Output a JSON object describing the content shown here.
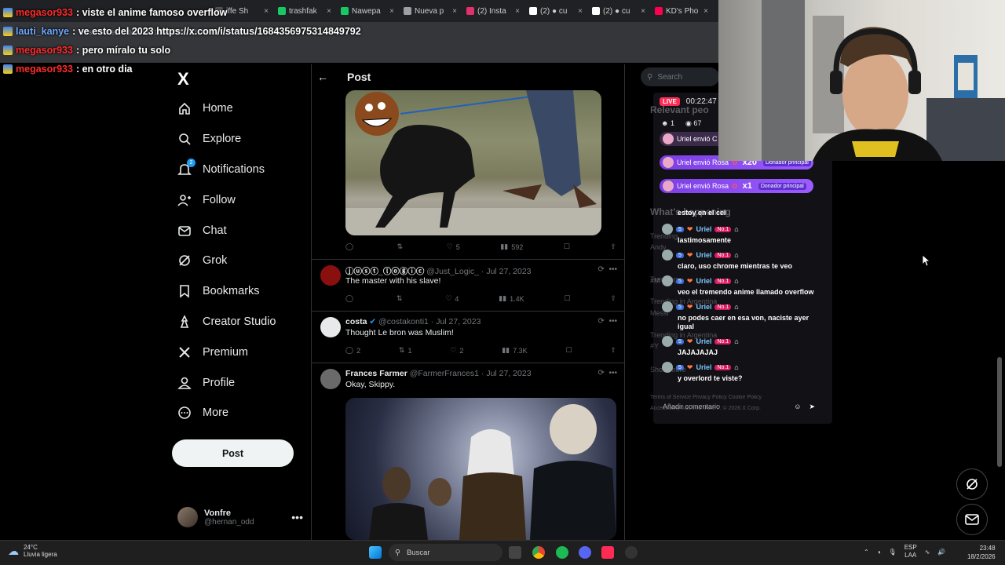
{
  "browser": {
    "tabs": [
      {
        "label": "iffe Sh",
        "color": "#555555"
      },
      {
        "label": "trashfak",
        "color": "#17c964"
      },
      {
        "label": "Nawepa",
        "color": "#17c964"
      },
      {
        "label": "Nueva p",
        "color": "#9aa0a6"
      },
      {
        "label": "(2) Insta",
        "color": "#e1306c"
      },
      {
        "label": "(2) ● cu",
        "color": "#ffffff"
      },
      {
        "label": "(2) ● cu",
        "color": "#ffffff"
      },
      {
        "label": "KD's Pho",
        "color": "#ff0050"
      }
    ],
    "address_fragment": "Vision4theBlind/status/1684356975314849792"
  },
  "stream_chat": [
    {
      "user": "megasor933",
      "text": ": viste el anime famoso overflow",
      "user_color": "red"
    },
    {
      "user": "lauti_kanye",
      "text": ": ve esto del 2023 https://x.com/i/status/1684356975314849792",
      "user_color": "blue"
    },
    {
      "user": "megasor933",
      "text": ": pero míralo tu solo",
      "user_color": "red"
    },
    {
      "user": "megasor933",
      "text": ": en otro dia",
      "user_color": "red"
    }
  ],
  "nav": {
    "logo": "X",
    "items": [
      "Home",
      "Explore",
      "Notifications",
      "Follow",
      "Chat",
      "Grok",
      "Bookmarks",
      "Creator Studio",
      "Premium",
      "Profile",
      "More"
    ],
    "notifications_badge": "2",
    "post_button": "Post"
  },
  "account": {
    "name": "Vonfre",
    "handle": "@hernan_odd",
    "menu": "•••"
  },
  "feed": {
    "title": "Post",
    "first_actions": {
      "reply": "",
      "repost": "",
      "like": "5",
      "views": "592"
    },
    "tweets": [
      {
        "name": "ⓙⓤⓢⓣ_ⓛⓞⓖⓘⓒ",
        "handle": "@Just_Logic_",
        "date": "Jul 27, 2023",
        "text": "The master with his slave!",
        "reply": "",
        "repost": "",
        "like": "4",
        "views": "1.4K",
        "avatar": "#8a1010"
      },
      {
        "name": "costa",
        "handle": "@costakonti1",
        "date": "Jul 27, 2023",
        "text": "Thought Le bron was Muslim!",
        "reply": "2",
        "repost": "1",
        "like": "2",
        "views": "7.3K",
        "avatar": "#e7e9ea"
      },
      {
        "name": "Frances Farmer",
        "handle": "@FarmerFrances1",
        "date": "Jul 27, 2023",
        "text": "Okay, Skippy.",
        "avatar": "#6a6a6a"
      }
    ]
  },
  "right": {
    "search_placeholder": "Search",
    "ghost_relevant": "Relevant peo",
    "ghost_happening": "What's happening",
    "ghost_lines": [
      "Trending",
      "Andy",
      "Trending",
      "#M",
      "Trending in Argentina",
      "Messi",
      "Trending in Argentina",
      "#Y",
      "Show more",
      "Terms of Service  Privacy Policy  Cookie Policy",
      "Accessibility  Ads info  More ... © 2026 X Corp."
    ]
  },
  "live": {
    "badge": "LIVE",
    "timer": "00:22:47",
    "viewers": "1",
    "views": "67",
    "gifts": [
      {
        "text": "Uriel envió C",
        "mult": ""
      },
      {
        "text": "Uriel envió Rosa",
        "mult": "x20",
        "tag": "Donador principal"
      },
      {
        "text": "Uriel envió Rosa",
        "mult": "x1",
        "tag": "Donador principal"
      }
    ],
    "first_comment": "estoy en el cel",
    "user": "Uriel",
    "level": "5",
    "rank": "No.1",
    "comments": [
      "lastimosamente",
      "claro, uso chrome mientras te veo",
      "veo el tremendo anime llamado overflow",
      "no podes caer en esa von, naciste ayer igual",
      "JAJAJAJAJ",
      "y overlord te viste?"
    ],
    "add_comment_placeholder": "Añadir comentario"
  },
  "taskbar": {
    "temp": "24°C",
    "weather": "Lluvia ligera",
    "search": "Buscar",
    "lang1": "ESP",
    "lang2": "LAA",
    "time": "23:48",
    "date": "18/2/2026"
  }
}
